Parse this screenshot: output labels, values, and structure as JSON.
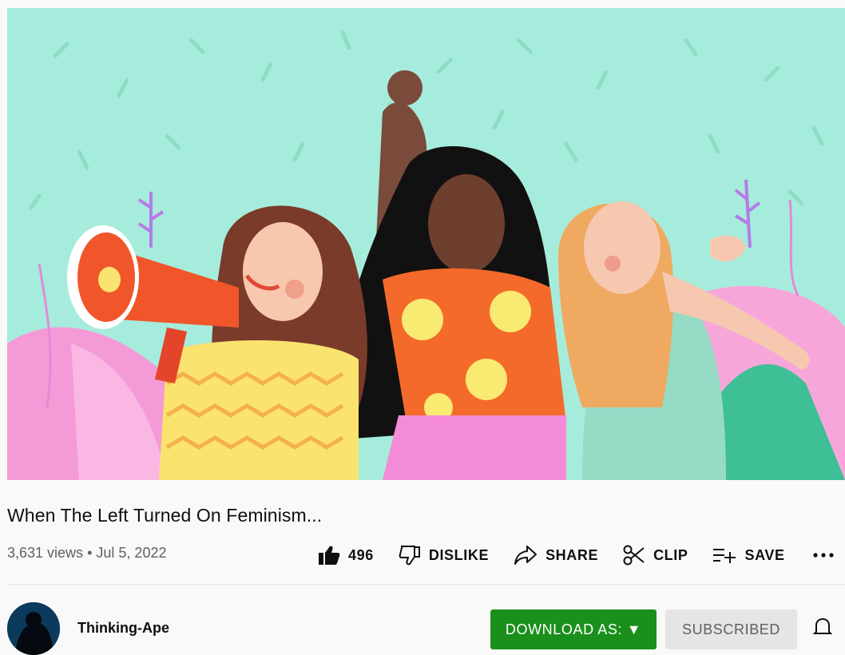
{
  "video": {
    "title": "When The Left Turned On Feminism...",
    "views": "3,631 views",
    "separator": "•",
    "date": "Jul 5, 2022"
  },
  "actions": {
    "like_count": "496",
    "dislike_label": "DISLIKE",
    "share_label": "SHARE",
    "clip_label": "CLIP",
    "save_label": "SAVE"
  },
  "channel": {
    "name": "Thinking-Ape",
    "download_label": "DOWNLOAD AS: ▼",
    "subscribed_label": "SUBSCRIBED"
  },
  "colors": {
    "thumbnail_bg": "#a6ecdc",
    "download_bg": "#1b8f1b",
    "subscribed_bg": "#e5e5e5"
  },
  "icons": {
    "like": "thumbs-up-icon",
    "dislike": "thumbs-down-icon",
    "share": "share-arrow-icon",
    "clip": "scissors-icon",
    "save": "playlist-add-icon",
    "more": "more-horizontal-icon",
    "notifications": "bell-icon"
  }
}
